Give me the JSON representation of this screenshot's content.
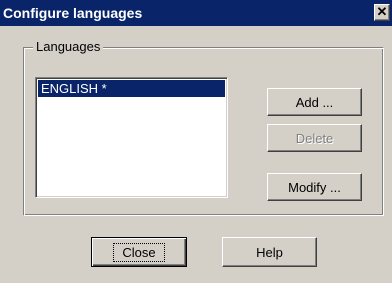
{
  "window": {
    "title": "Configure languages",
    "close_glyph": "✕"
  },
  "group": {
    "label": "Languages"
  },
  "languages": {
    "items": [
      {
        "label": "ENGLISH *",
        "selected": true
      }
    ]
  },
  "buttons": {
    "add": "Add ...",
    "delete": "Delete",
    "modify": "Modify ...",
    "close": "Close",
    "help": "Help"
  },
  "colors": {
    "titlebar": "#0a246a",
    "face": "#d4d0c8",
    "selection": "#0a246a"
  }
}
